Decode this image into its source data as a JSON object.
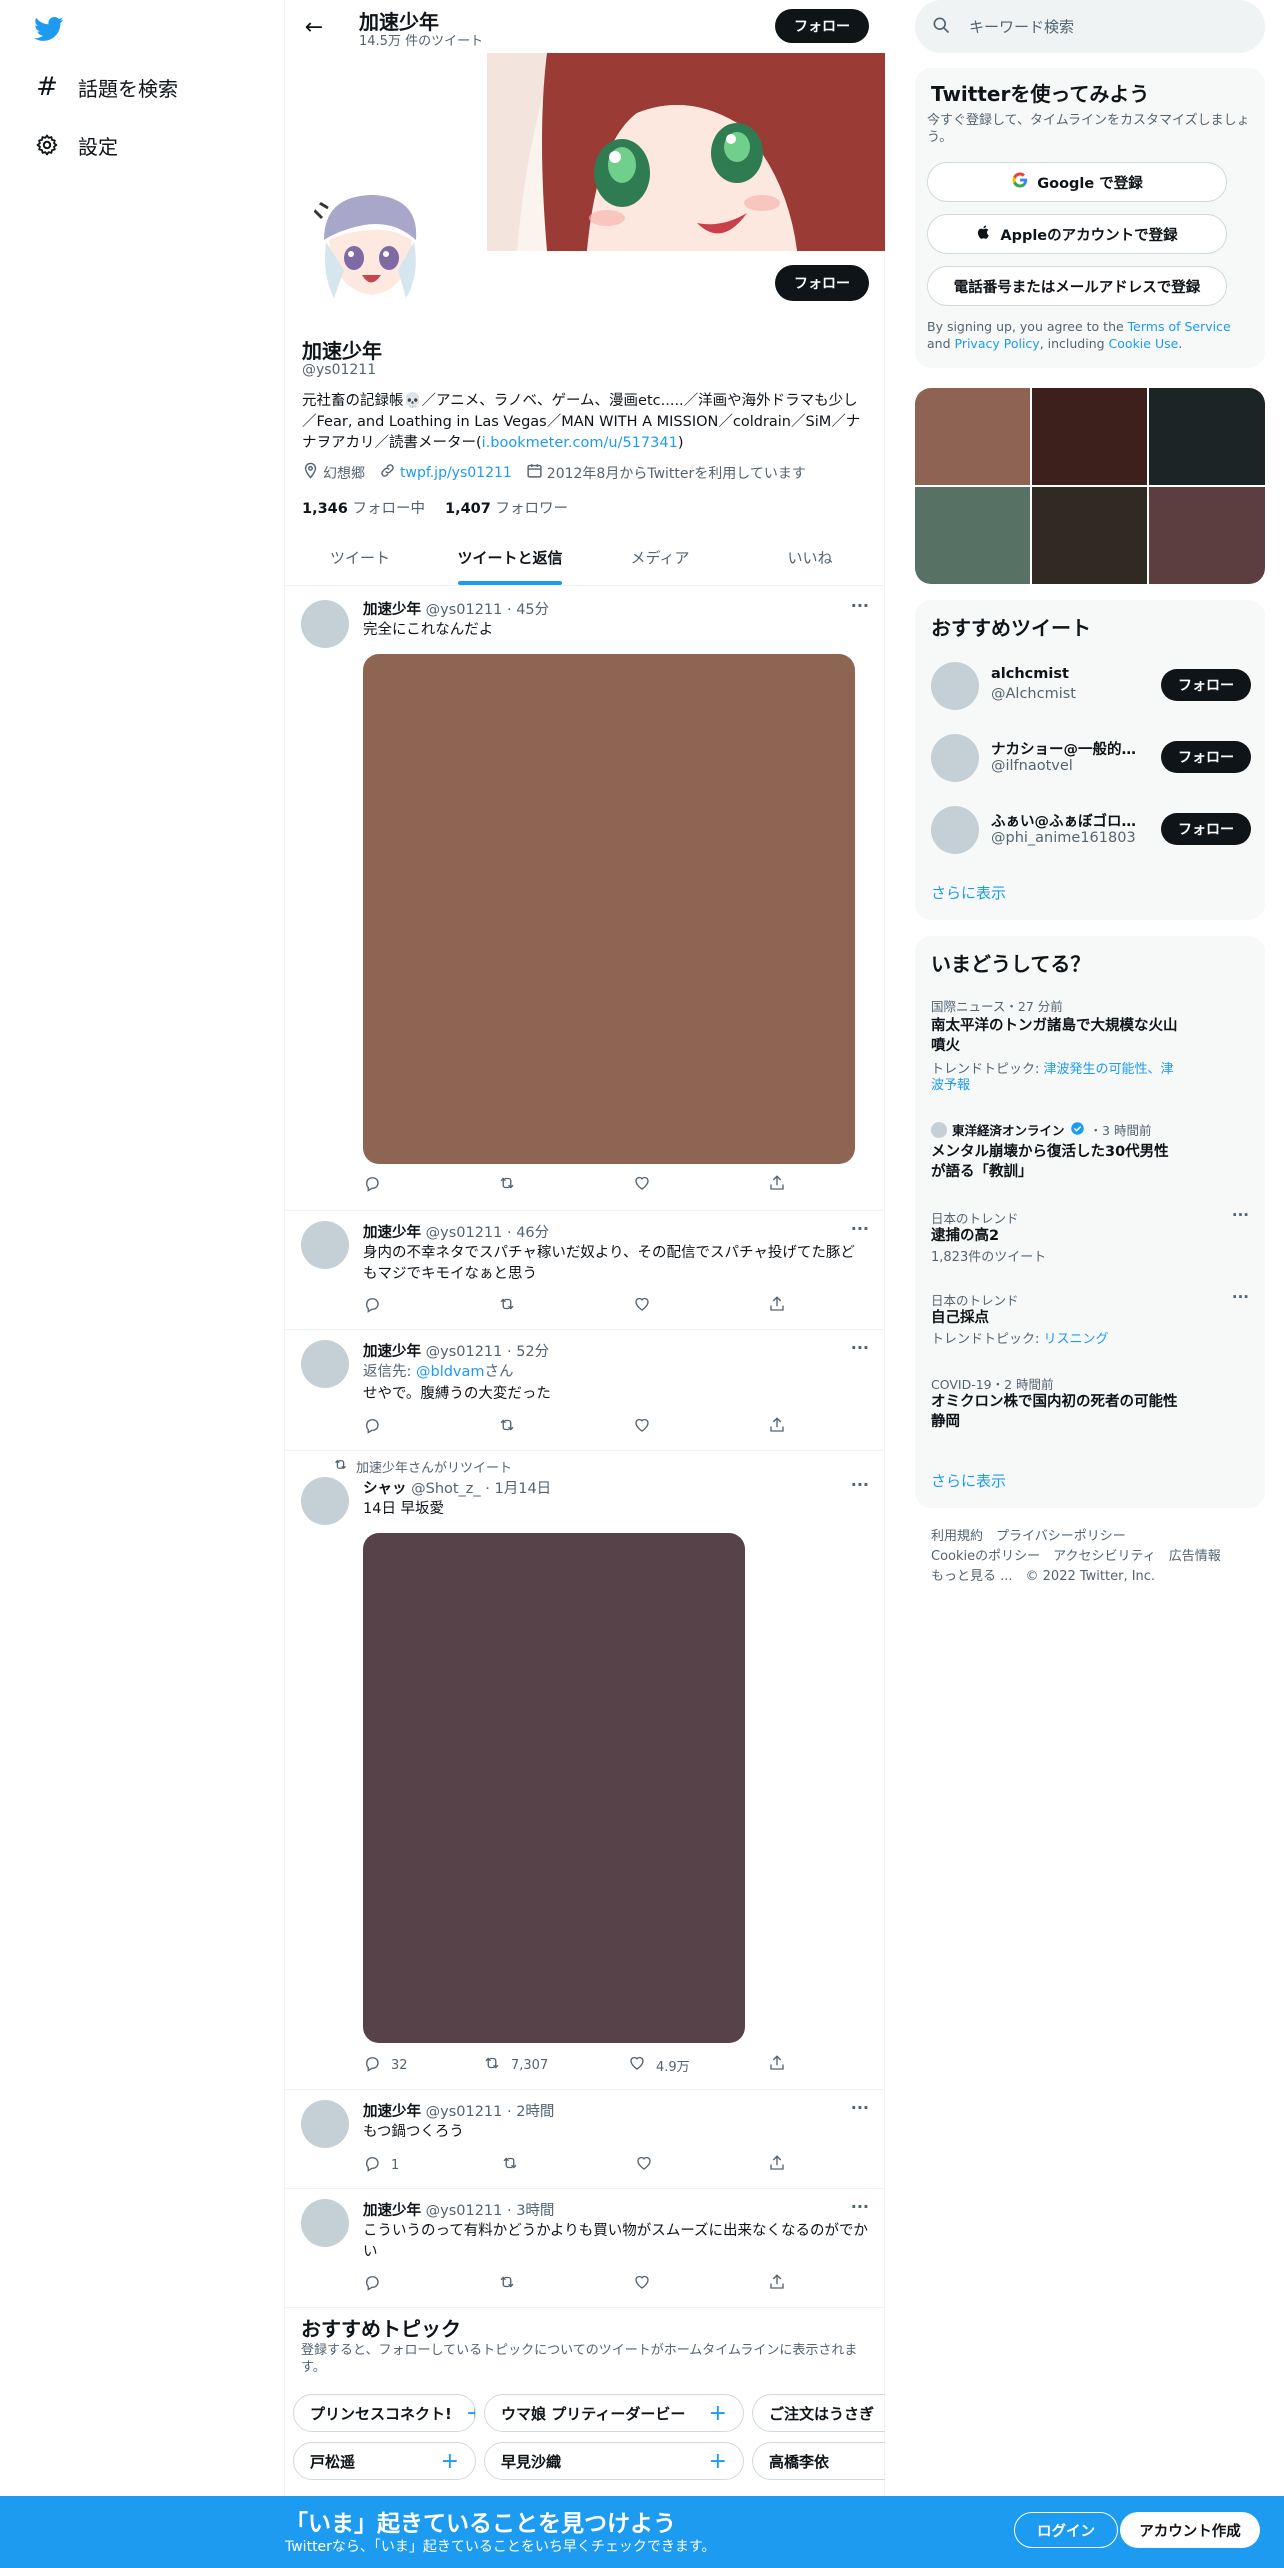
{
  "nav": {
    "explore_label": "話題を検索",
    "settings_label": "設定"
  },
  "header": {
    "name": "加速少年",
    "tweet_count": "14.5万 件のツイート",
    "follow_label": "フォロー"
  },
  "profile": {
    "name": "加速少年",
    "handle": "@ys01211",
    "follow_label": "フォロー",
    "bio_text": "元社畜の記録帳💀／アニメ、ラノベ、ゲーム、漫画etc.....／洋画や海外ドラマも少し／Fear, and Loathing in Las Vegas／MAN WITH A MISSION／coldrain／SiM／ナナヲアカリ／読書メーター(",
    "bio_link": "i.bookmeter.com/u/517341",
    "bio_end": ")",
    "location": "幻想郷",
    "website": "twpf.jp/ys01211",
    "joined": "2012年8月からTwitterを利用しています",
    "following_count": "1,346",
    "following_label": "フォロー中",
    "followers_count": "1,407",
    "followers_label": "フォロワー"
  },
  "tabs": [
    "ツイート",
    "ツイートと返信",
    "メディア",
    "いいね"
  ],
  "tweets": [
    {
      "name": "加速少年",
      "meta": "@ys01211 · 45分",
      "text": "完全にこれなんだよ",
      "image_color": "#8e6453"
    },
    {
      "name": "加速少年",
      "meta": "@ys01211 · 46分",
      "text": "身内の不幸ネタでスパチャ稼いだ奴より、その配信でスパチャ投げてた豚どもマジでキモイなぁと思う"
    },
    {
      "name": "加速少年",
      "meta": "@ys01211 · 52分",
      "reply_prefix": "返信先: ",
      "reply_to": "@bldvam",
      "reply_suffix": "さん",
      "text": "せやで。腹縛うの大変だった"
    },
    {
      "retweet_label": "加速少年さんがリツイート",
      "name": "シャッ",
      "meta": "@Shot_z_ · 1月14日",
      "text": "14日 早坂愛",
      "image_color": "#57424a",
      "replies": "32",
      "retweets": "7,307",
      "likes": "4.9万"
    },
    {
      "name": "加速少年",
      "meta": "@ys01211 · 2時間",
      "text": "もつ鍋つくろう",
      "replies": "1"
    },
    {
      "name": "加速少年",
      "meta": "@ys01211 · 3時間",
      "text": "こういうのって有料かどうかよりも買い物がスムーズに出来なくなるのがでかい"
    }
  ],
  "topics": {
    "title": "おすすめトピック",
    "subtitle": "登録すると、フォローしているトピックについてのツイートがホームタイムラインに表示されます。",
    "row1": [
      "プリンセスコネクト!",
      "ウマ娘 プリティーダービー",
      "ご注文はうさぎ"
    ],
    "row2": [
      "戸松遥",
      "早見沙織",
      "高橋李依"
    ]
  },
  "search": {
    "placeholder": "キーワード検索"
  },
  "signup_box": {
    "title": "Twitterを使ってみよう",
    "subtitle": "今すぐ登録して、タイムラインをカスタマイズしましょう。",
    "google": "Google で登録",
    "apple": "Appleのアカウントで登録",
    "phone": "電話番号またはメールアドレスで登録",
    "legal_pre": "By signing up, you agree to the ",
    "tos": "Terms of Service",
    "and": " and ",
    "privacy": "Privacy Policy",
    "including": ", including ",
    "cookie": "Cookie Use",
    "period": "."
  },
  "media_grid": [
    "#8f6353",
    "#3d1f1c",
    "#1c2526",
    "#577164",
    "#312a22",
    "#5c3e40"
  ],
  "suggested": {
    "title": "おすすめツイート",
    "users": [
      {
        "name": "alchcmist",
        "handle": "@Alchcmist"
      },
      {
        "name": "ナカショー@一般的な男子です",
        "handle": "@ilfnaotvel"
      },
      {
        "name": "ふぁい@ふぁぼゴロゴロ",
        "handle": "@phi_anime161803"
      }
    ],
    "follow_label": "フォロー",
    "more": "さらに表示"
  },
  "trends": {
    "title": "いまどうしてる？",
    "items": [
      {
        "category": "国際ニュース・27 分前",
        "title": "南太平洋のトンガ諸島で大規模な火山噴火",
        "sub_prefix": "トレンドトピック: ",
        "sub_link": "津波発生の可能性、津波予報"
      },
      {
        "source": "東洋経済オンライン",
        "time": "・3 時間前",
        "title": "メンタル崩壊から復活した30代男性が語る「教訓」"
      },
      {
        "category": "日本のトレンド",
        "title": "逮捕の高2",
        "sub": "1,823件のツイート"
      },
      {
        "category": "日本のトレンド",
        "title": "自己採点",
        "sub_prefix": "トレンドトピック: ",
        "sub_link": "リスニング"
      },
      {
        "category": "COVID-19・2 時間前",
        "title": "オミクロン株で国内初の死者の可能性 静岡"
      }
    ],
    "more": "さらに表示"
  },
  "footer": {
    "line1": "利用規約　プライバシーポリシー",
    "line2": "Cookieのポリシー　アクセシビリティ　広告情報",
    "line3": "もっと見る ...　© 2022 Twitter, Inc."
  },
  "bottom_bar": {
    "title": "「いま」起きていることを見つけよう",
    "subtitle": "Twitterなら、「いま」起きていることをいち早くチェックできます。",
    "login": "ログイン",
    "signup": "アカウント作成"
  },
  "colors": {
    "accent": "#1d9bf0",
    "text": "#0f1419",
    "muted": "#536471"
  }
}
